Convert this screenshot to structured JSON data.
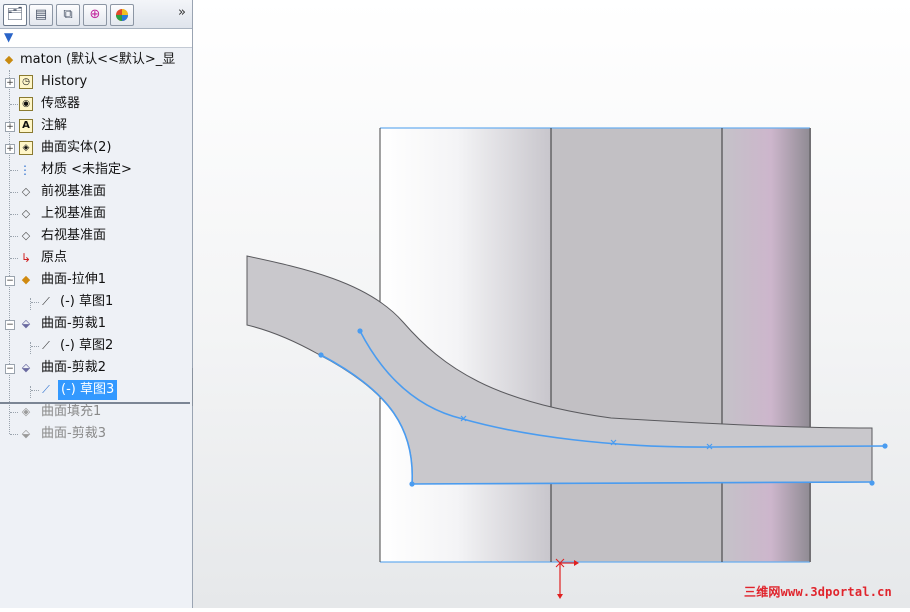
{
  "tabs": [
    {
      "name": "feature-manager",
      "icon": "feature-tree-icon"
    },
    {
      "name": "property-manager",
      "icon": "property-icon"
    },
    {
      "name": "configuration-manager",
      "icon": "configuration-icon"
    },
    {
      "name": "dim-xpert",
      "icon": "target-icon"
    },
    {
      "name": "display-manager",
      "icon": "appearance-icon"
    }
  ],
  "more_label": "»",
  "tree": {
    "root": "maton  (默认<<默认>_显",
    "items": [
      {
        "label": "History",
        "icon": "history-icon",
        "expandable": true
      },
      {
        "label": "传感器",
        "icon": "sensor-icon",
        "expandable": false
      },
      {
        "label": "注解",
        "icon": "annotation-icon",
        "expandable": true
      },
      {
        "label": "曲面实体(2)",
        "icon": "surface-bodies-icon",
        "expandable": true
      },
      {
        "label": "材质 <未指定>",
        "icon": "material-icon",
        "expandable": false
      },
      {
        "label": "前视基准面",
        "icon": "plane-icon",
        "expandable": false
      },
      {
        "label": "上视基准面",
        "icon": "plane-icon",
        "expandable": false
      },
      {
        "label": "右视基准面",
        "icon": "plane-icon",
        "expandable": false
      },
      {
        "label": "原点",
        "icon": "origin-icon",
        "expandable": false
      },
      {
        "label": "曲面-拉伸1",
        "icon": "extrude-surface-icon",
        "expandable": true
      },
      {
        "label": "(-) 草图1",
        "icon": "sketch-icon",
        "child": true
      },
      {
        "label": "曲面-剪裁1",
        "icon": "trim-surface-icon",
        "expandable": true
      },
      {
        "label": "(-) 草图2",
        "icon": "sketch-icon",
        "child": true
      },
      {
        "label": "曲面-剪裁2",
        "icon": "trim-surface-icon",
        "expandable": true
      },
      {
        "label": "(-) 草图3",
        "icon": "sketch-icon",
        "child": true,
        "selected": true
      },
      {
        "label": "曲面填充1",
        "icon": "fill-surface-icon",
        "suppressed": true
      },
      {
        "label": "曲面-剪裁3",
        "icon": "trim-surface-icon",
        "suppressed": true
      }
    ]
  },
  "watermark": "三维网www.3dportal.cn",
  "colors": {
    "selection": "#3399ff",
    "sketch_line": "#4a9cf0",
    "origin": "#e02020",
    "watermark": "#e0242c"
  }
}
